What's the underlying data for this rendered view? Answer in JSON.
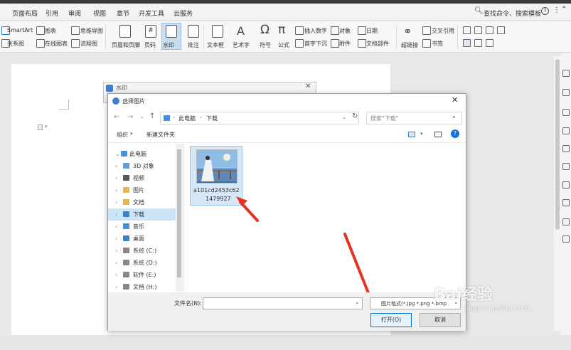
{
  "menu": {
    "items": [
      "页面布局",
      "引用",
      "审阅",
      "视图",
      "章节",
      "开发工具",
      "云服务"
    ],
    "search_label": "查找命令、搜索模板"
  },
  "ribbon": {
    "smartart": "SmartArt",
    "chart": "图表",
    "mindmap": "思维导图",
    "relation": "关系图",
    "online_chart": "在线图表",
    "flowchart": "流程图",
    "header_footer": "页眉和页脚",
    "page_num": "页码",
    "watermark": "水印",
    "comment": "批注",
    "textbox": "文本框",
    "art_text": "艺术字",
    "symbol": "符号",
    "formula": "公式",
    "insert_number": "插入数字",
    "object": "对象",
    "date": "日期",
    "drop_cap": "首字下沉",
    "attachment": "附件",
    "doc_parts": "文档部件",
    "hyperlink": "超链接",
    "cross_ref": "交叉引用",
    "bookmark": "书签"
  },
  "watermark_dialog": {
    "title": "水印"
  },
  "file_dialog": {
    "title": "选择图片",
    "breadcrumb": [
      "此电脑",
      "下载"
    ],
    "search_placeholder": "搜索\"下载\"",
    "organize": "组织",
    "new_folder": "新建文件夹",
    "tree": [
      {
        "label": "此电脑",
        "chev": "⌄"
      },
      {
        "label": "3D 对象",
        "chev": "›"
      },
      {
        "label": "视频",
        "chev": "›"
      },
      {
        "label": "图片",
        "chev": "›"
      },
      {
        "label": "文档",
        "chev": "›"
      },
      {
        "label": "下载",
        "chev": "›"
      },
      {
        "label": "音乐",
        "chev": "›"
      },
      {
        "label": "桌面",
        "chev": "›"
      },
      {
        "label": "系统 (C:)",
        "chev": "›"
      },
      {
        "label": "系统 (D:)",
        "chev": "›"
      },
      {
        "label": "软件 (E:)",
        "chev": "›"
      },
      {
        "label": "文档 (H:)",
        "chev": "›"
      }
    ],
    "file": {
      "name_line1": "a101cd2453c62",
      "name_line2": "1479927"
    },
    "filename_label": "文件名(N):",
    "filetype": "图片格式(*.jpg *.png *.bmp",
    "open_button": "打开(O)",
    "cancel_button": "取消"
  },
  "watermark_text": {
    "brand": "Bai经验",
    "url": "jingyan.baidu.com"
  }
}
